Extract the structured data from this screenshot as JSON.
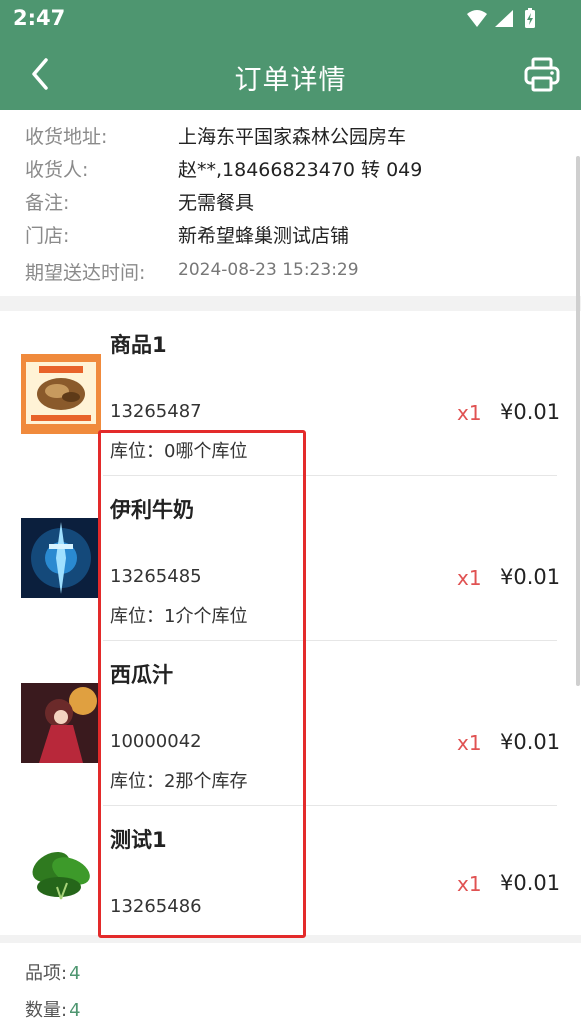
{
  "status_bar": {
    "time": "2:47",
    "icons": [
      "wifi-icon",
      "signal-icon",
      "battery-icon"
    ]
  },
  "header": {
    "title": "订单详情",
    "back_icon": "back-arrow-icon",
    "print_icon": "printer-icon"
  },
  "order_info": {
    "address": {
      "label": "收货地址:",
      "value": "上海东平国家森林公园房车"
    },
    "receiver": {
      "label": "收货人:",
      "value": "赵**,18466823470 转 049"
    },
    "note": {
      "label": "备注:",
      "value": "无需餐具"
    },
    "store": {
      "label": "门店:",
      "value": "新希望蜂巢测试店铺"
    },
    "expected_time": {
      "label": "期望送达时间:",
      "value": "2024-08-23 15:23:29"
    }
  },
  "goods": [
    {
      "name": "商品1",
      "code": "13265487",
      "location": "库位：0哪个库位",
      "qty": "x1",
      "price": "¥0.01"
    },
    {
      "name": "伊利牛奶",
      "code": "13265485",
      "location": "库位：1介个库位",
      "qty": "x1",
      "price": "¥0.01"
    },
    {
      "name": "西瓜汁",
      "code": "10000042",
      "location": "库位：2那个库存",
      "qty": "x1",
      "price": "¥0.01"
    },
    {
      "name": "测试1",
      "code": "13265486",
      "location": "",
      "qty": "x1",
      "price": "¥0.01"
    }
  ],
  "summary": {
    "items": {
      "label": "品项:",
      "value": "4"
    },
    "quantity": {
      "label": "数量:",
      "value": "4"
    }
  },
  "colors": {
    "primary": "#4e9670",
    "qty": "#e05252",
    "highlight": "#e32a2a"
  }
}
